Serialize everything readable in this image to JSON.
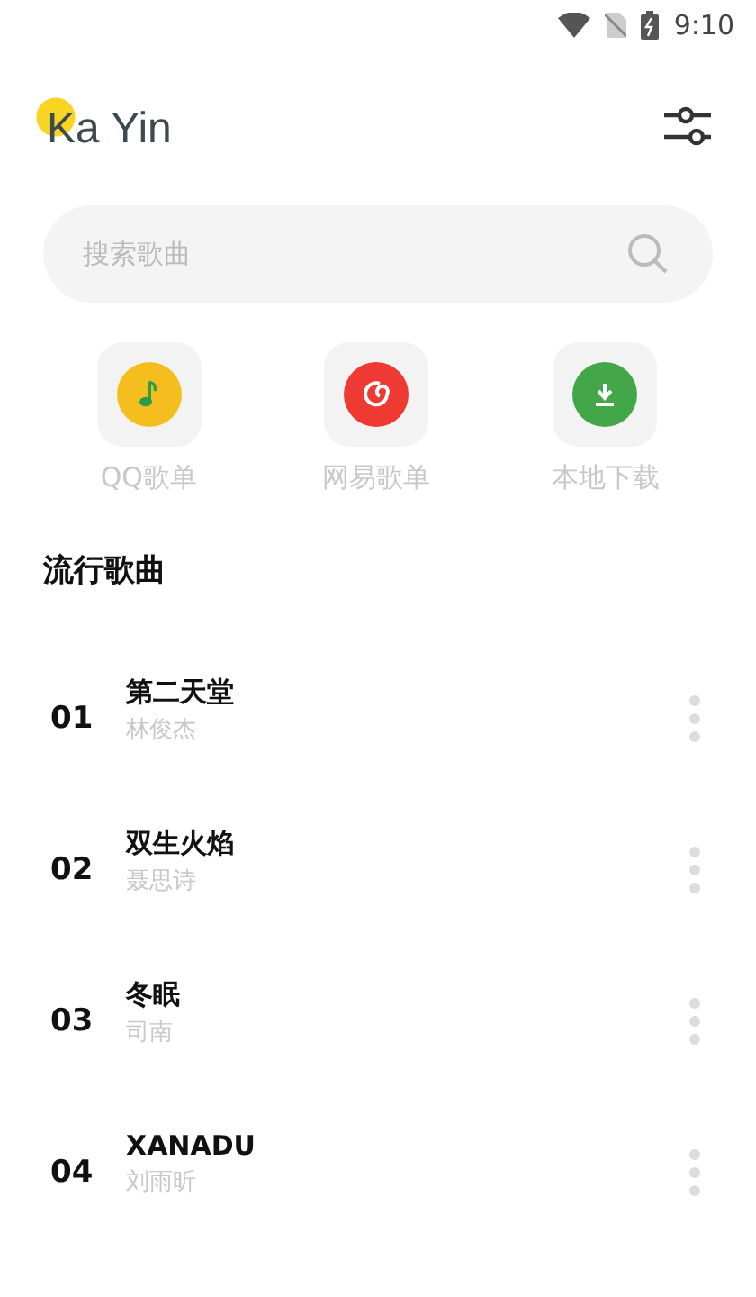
{
  "status_bar": {
    "time": "9:10"
  },
  "header": {
    "title": "Ka Yin"
  },
  "search": {
    "placeholder": "搜索歌曲"
  },
  "shortcuts": [
    {
      "label": "QQ歌单",
      "kind": "note",
      "color": "#f5be1e"
    },
    {
      "label": "网易歌单",
      "kind": "swirl",
      "color": "#ee3a32"
    },
    {
      "label": "本地下载",
      "kind": "download",
      "color": "#43a648"
    }
  ],
  "section_title": "流行歌曲",
  "songs": [
    {
      "rank": "01",
      "title": "第二天堂",
      "artist": "林俊杰"
    },
    {
      "rank": "02",
      "title": "双生火焰",
      "artist": "聂思诗"
    },
    {
      "rank": "03",
      "title": "冬眠",
      "artist": "司南"
    },
    {
      "rank": "04",
      "title": "XANADU",
      "artist": "刘雨昕"
    }
  ]
}
